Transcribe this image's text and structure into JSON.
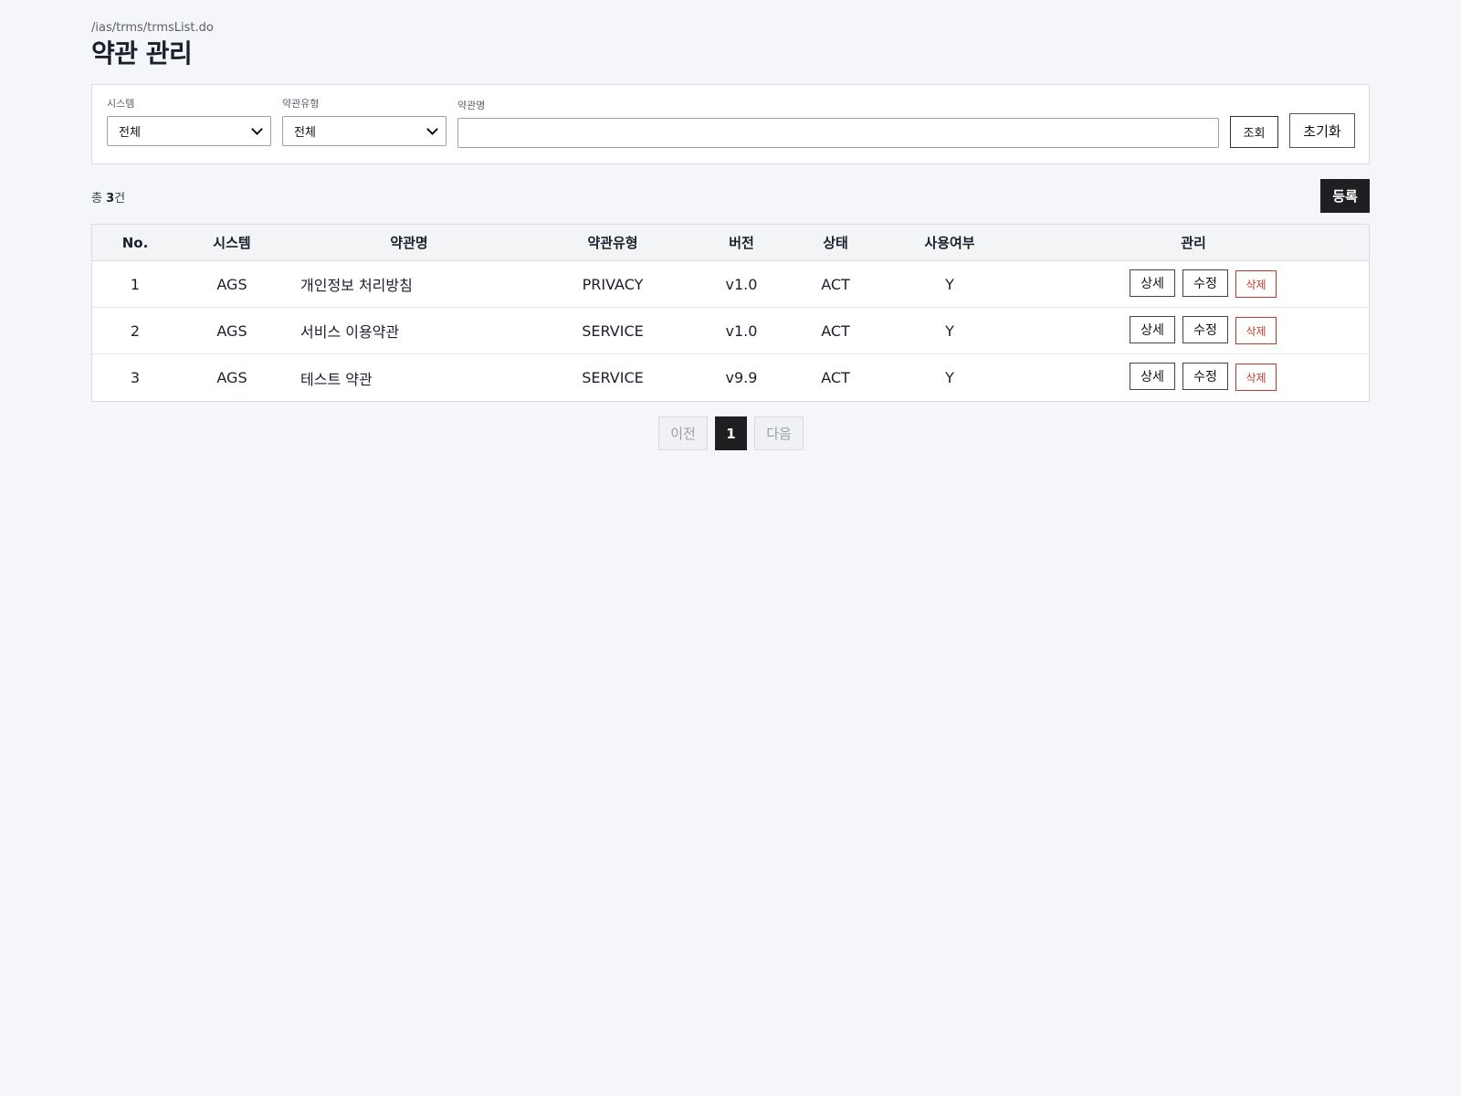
{
  "header": {
    "path": "/ias/trms/trmsList.do",
    "title": "약관 관리"
  },
  "search": {
    "system_label": "시스템",
    "system_value": "전체",
    "type_label": "약관유형",
    "type_value": "전체",
    "name_label": "약관명",
    "name_value": "",
    "search_button": "조회",
    "reset_button": "초기화"
  },
  "summary": {
    "prefix": "총 ",
    "count": "3",
    "suffix": "건",
    "register_button": "등록"
  },
  "table": {
    "headers": [
      "No.",
      "시스템",
      "약관명",
      "약관유형",
      "버전",
      "상태",
      "사용여부",
      "관리"
    ],
    "rows": [
      {
        "no": "1",
        "system": "AGS",
        "name": "개인정보 처리방침",
        "type": "PRIVACY",
        "version": "v1.0",
        "status": "ACT",
        "use": "Y"
      },
      {
        "no": "2",
        "system": "AGS",
        "name": "서비스 이용약관",
        "type": "SERVICE",
        "version": "v1.0",
        "status": "ACT",
        "use": "Y"
      },
      {
        "no": "3",
        "system": "AGS",
        "name": "테스트 약관",
        "type": "SERVICE",
        "version": "v9.9",
        "status": "ACT",
        "use": "Y"
      }
    ],
    "actions": {
      "detail": "상세",
      "edit": "수정",
      "delete": "삭제"
    }
  },
  "pagination": {
    "prev": "이전",
    "current": "1",
    "next": "다음"
  },
  "colors": {
    "background": "#f5f6fa",
    "dark_button": "#1e1f21",
    "danger": "#c0392b"
  }
}
